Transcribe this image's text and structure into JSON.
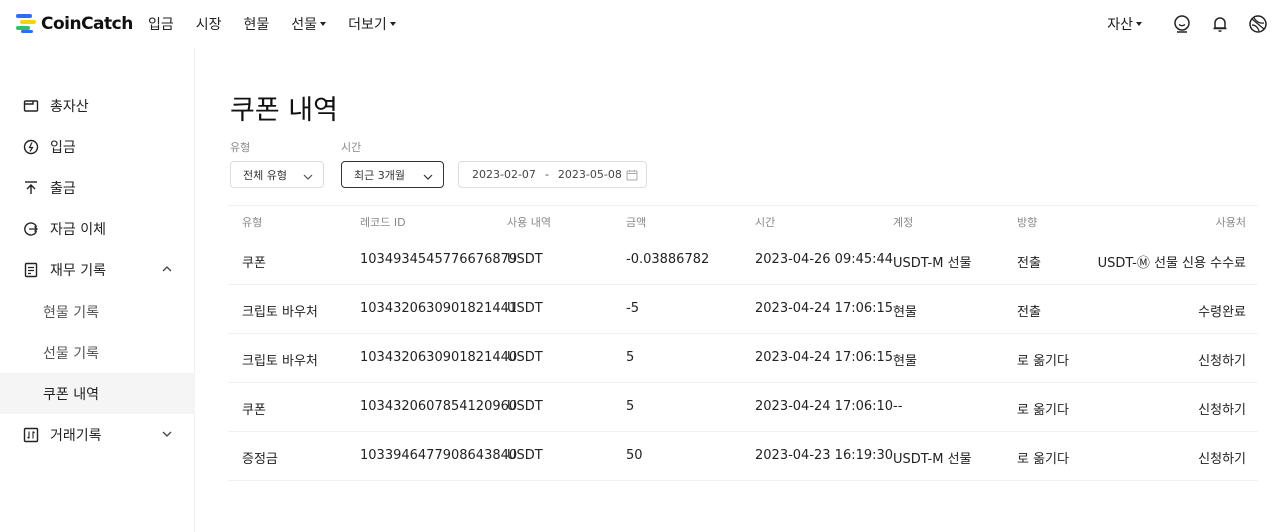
{
  "brand": {
    "name": "CoinCatch",
    "colors": {
      "blue": "#2b6df3",
      "yellow": "#f5d40f",
      "green": "#2fc06b"
    }
  },
  "nav": {
    "items": [
      {
        "label": "입금",
        "dropdown": false
      },
      {
        "label": "시장",
        "dropdown": false
      },
      {
        "label": "현물",
        "dropdown": false
      },
      {
        "label": "선물",
        "dropdown": true
      },
      {
        "label": "더보기",
        "dropdown": true
      }
    ],
    "asset_label": "자산",
    "icons": [
      "profile-icon",
      "bell-icon",
      "globe-icon"
    ]
  },
  "sidebar": {
    "items": [
      {
        "label": "총자산",
        "icon": "wallet-icon"
      },
      {
        "label": "입금",
        "icon": "deposit-icon"
      },
      {
        "label": "출금",
        "icon": "withdraw-icon"
      },
      {
        "label": "자금 이체",
        "icon": "transfer-icon"
      },
      {
        "label": "재무 기록",
        "icon": "document-icon",
        "expanded": true
      },
      {
        "label": "거래기록",
        "icon": "trade-record-icon",
        "expanded": false
      }
    ],
    "sub_items": [
      {
        "label": "현물 기록",
        "active": false
      },
      {
        "label": "선물 기록",
        "active": false
      },
      {
        "label": "쿠폰 내역",
        "active": true
      }
    ]
  },
  "page": {
    "title": "쿠폰 내역"
  },
  "filters": {
    "type_label": "유형",
    "type_value": "전체 유형",
    "time_label": "시간",
    "time_value": "최근 3개월",
    "date_start": "2023-02-07",
    "date_sep": "-",
    "date_end": "2023-05-08"
  },
  "table": {
    "headers": [
      "유형",
      "레코드 ID",
      "사용 내역",
      "금액",
      "시간",
      "계정",
      "방향",
      "사용처"
    ],
    "rows": [
      [
        "쿠폰",
        "1034934545776676879",
        "USDT",
        "-0.03886782",
        "2023-04-26 09:45:44",
        "USDT-M 선물",
        "전출",
        "USDT-Ⓜ 선물 신용 수수료"
      ],
      [
        "크립토 바우처",
        "1034320630901821441",
        "USDT",
        "-5",
        "2023-04-24 17:06:15",
        "현물",
        "전출",
        "수령완료"
      ],
      [
        "크립토 바우처",
        "1034320630901821440",
        "USDT",
        "5",
        "2023-04-24 17:06:15",
        "현물",
        "로 옮기다",
        "신청하기"
      ],
      [
        "쿠폰",
        "1034320607854120960",
        "USDT",
        "5",
        "2023-04-24 17:06:10",
        "--",
        "로 옮기다",
        "신청하기"
      ],
      [
        "증정금",
        "1033946477908643840",
        "USDT",
        "50",
        "2023-04-23 16:19:30",
        "USDT-M 선물",
        "로 옮기다",
        "신청하기"
      ]
    ]
  }
}
